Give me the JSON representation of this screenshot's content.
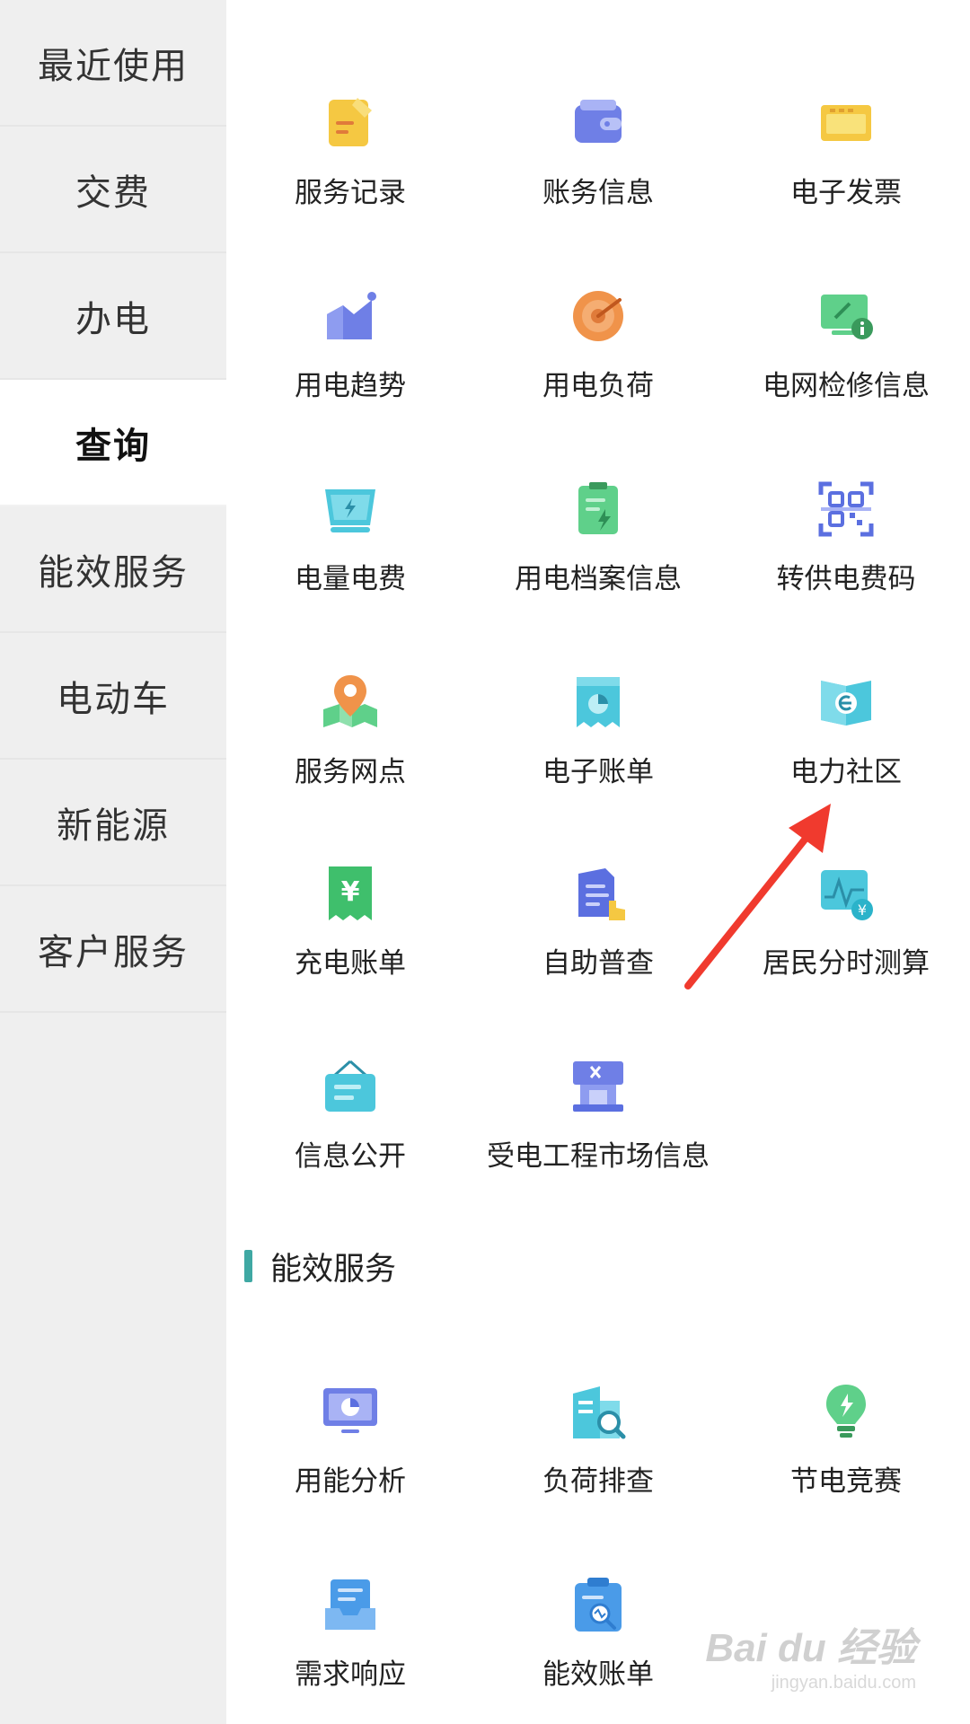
{
  "sidebar": {
    "items": [
      {
        "label": "最近使用",
        "active": false
      },
      {
        "label": "交费",
        "active": false
      },
      {
        "label": "办电",
        "active": false
      },
      {
        "label": "查询",
        "active": true
      },
      {
        "label": "能效服务",
        "active": false
      },
      {
        "label": "电动车",
        "active": false
      },
      {
        "label": "新能源",
        "active": false
      },
      {
        "label": "客户服务",
        "active": false
      }
    ]
  },
  "query_section": {
    "items": [
      {
        "label": "服务记录",
        "icon": "note-icon"
      },
      {
        "label": "账务信息",
        "icon": "wallet-icon"
      },
      {
        "label": "电子发票",
        "icon": "invoice-icon"
      },
      {
        "label": "用电趋势",
        "icon": "trend-chart-icon"
      },
      {
        "label": "用电负荷",
        "icon": "gauge-icon"
      },
      {
        "label": "电网检修信息",
        "icon": "grid-maintenance-icon"
      },
      {
        "label": "电量电费",
        "icon": "electricity-bill-icon"
      },
      {
        "label": "用电档案信息",
        "icon": "archive-icon"
      },
      {
        "label": "转供电费码",
        "icon": "qr-code-icon"
      },
      {
        "label": "服务网点",
        "icon": "map-pin-icon"
      },
      {
        "label": "电子账单",
        "icon": "e-bill-icon"
      },
      {
        "label": "电力社区",
        "icon": "community-book-icon"
      },
      {
        "label": "充电账单",
        "icon": "yuan-receipt-icon"
      },
      {
        "label": "自助普查",
        "icon": "self-check-icon"
      },
      {
        "label": "居民分时测算",
        "icon": "time-of-use-icon"
      },
      {
        "label": "信息公开",
        "icon": "signboard-icon"
      },
      {
        "label": "受电工程市场信息",
        "icon": "market-building-icon"
      }
    ]
  },
  "efficiency_section": {
    "title": "能效服务",
    "items": [
      {
        "label": "用能分析",
        "icon": "monitor-pie-icon"
      },
      {
        "label": "负荷排查",
        "icon": "building-search-icon"
      },
      {
        "label": "节电竞赛",
        "icon": "lightbulb-icon"
      },
      {
        "label": "需求响应",
        "icon": "tray-icon"
      },
      {
        "label": "能效账单",
        "icon": "clipboard-search-icon"
      }
    ]
  },
  "watermark": {
    "main": "Bai du 经验",
    "sub": "jingyan.baidu.com"
  },
  "colors": {
    "accent": "#3fa8a3",
    "arrow": "#f03a2e",
    "sidebar_bg": "#efefef"
  }
}
